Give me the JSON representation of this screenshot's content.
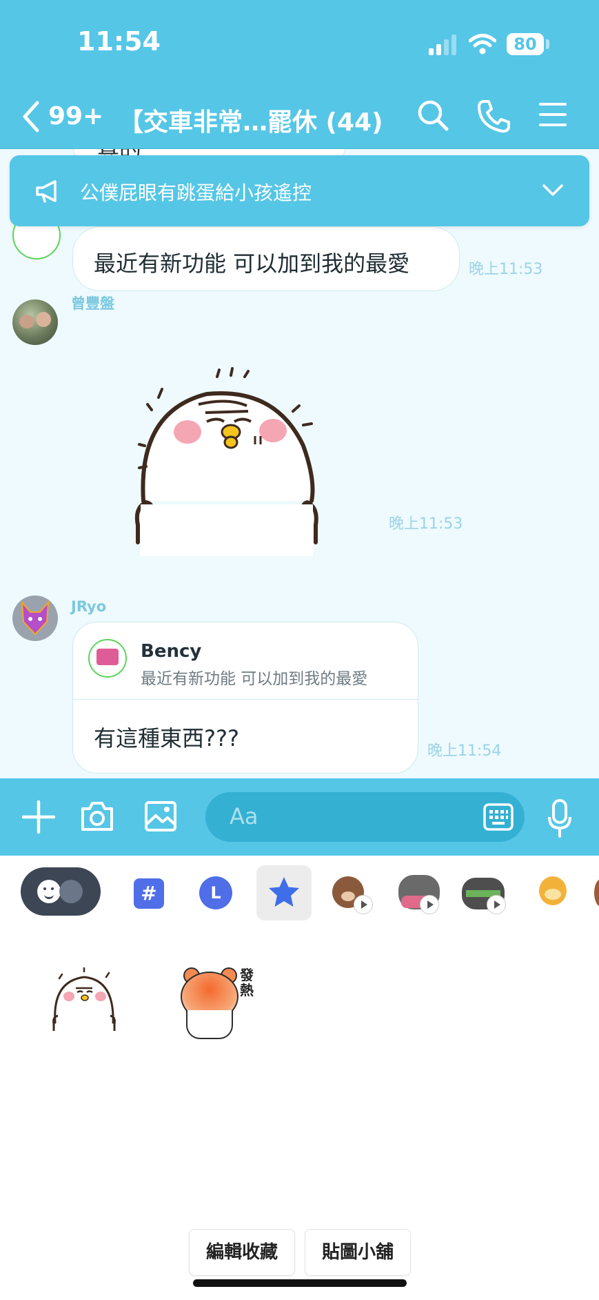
{
  "status_bar": {
    "time": "11:54",
    "battery": "80"
  },
  "header": {
    "back_count": "99+",
    "title": "【交車非常…罷休 (44)"
  },
  "announcement": {
    "text": "公僕屁眼有跳蛋給小孩遙控"
  },
  "messages": {
    "partial_top": "真的",
    "m1": {
      "text": "最近有新功能 可以加到我的最愛",
      "time": "晚上11:53"
    },
    "m2": {
      "sender": "曾豐盤",
      "time": "晚上11:53"
    },
    "m3": {
      "sender": "JRyo",
      "reply_name": "Bency",
      "reply_text": "最近有新功能 可以加到我的最愛",
      "text": "有這種東西???",
      "time": "晚上11:54"
    }
  },
  "input": {
    "placeholder": "Aa"
  },
  "sticker_tabs": [
    "emoji-tab",
    "hashtag-tab",
    "line-tab",
    "favorites-tab",
    "brown-tab",
    "cat-sticker-tab",
    "cat2-sticker-tab",
    "hamster-tab"
  ],
  "stickers": {
    "hot_label": "發熱"
  },
  "footer": {
    "edit_label": "編輯收藏",
    "store_label": "貼圖小舖"
  },
  "colors": {
    "accent": "#55c6e6",
    "chat_bg": "#eefafd",
    "timestamp": "#9bd3e6",
    "star": "#3f6ee8"
  }
}
